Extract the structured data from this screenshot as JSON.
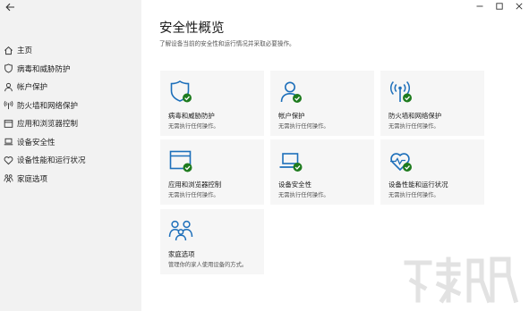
{
  "sidebar": {
    "items": [
      {
        "label": "主页",
        "icon": "home-icon"
      },
      {
        "label": "病毒和威胁防护",
        "icon": "shield-icon"
      },
      {
        "label": "帐户保护",
        "icon": "person-icon"
      },
      {
        "label": "防火墙和网络保护",
        "icon": "wireless-icon"
      },
      {
        "label": "应用和浏览器控制",
        "icon": "app-window-icon"
      },
      {
        "label": "设备安全性",
        "icon": "laptop-icon"
      },
      {
        "label": "设备性能和运行状况",
        "icon": "heart-icon"
      },
      {
        "label": "家庭选项",
        "icon": "family-icon"
      }
    ]
  },
  "header": {
    "title": "安全性概览",
    "subtitle": "了解设备当前的安全性和运行情况并采取必要操作。"
  },
  "tiles": [
    {
      "name": "病毒和威胁防护",
      "status": "无需执行任何操作。",
      "icon": "shield-icon"
    },
    {
      "name": "帐户保护",
      "status": "无需执行任何操作。",
      "icon": "person-icon"
    },
    {
      "name": "防火墙和网络保护",
      "status": "无需执行任何操作。",
      "icon": "wireless-icon"
    },
    {
      "name": "应用和浏览器控制",
      "status": "无需执行任何操作。",
      "icon": "app-window-icon"
    },
    {
      "name": "设备安全性",
      "status": "无需执行任何操作。",
      "icon": "laptop-icon"
    },
    {
      "name": "设备性能和运行状况",
      "status": "无需执行任何操作。",
      "icon": "heart-pulse-icon"
    },
    {
      "name": "家庭选项",
      "status": "管理你的家人使用设备的方式。",
      "icon": "family-icon"
    }
  ],
  "colors": {
    "accent": "#1d6fba",
    "ok_green": "#1e7b1e",
    "sidebar_bg": "#f2f2f2",
    "tile_bg": "#f6f6f6"
  }
}
